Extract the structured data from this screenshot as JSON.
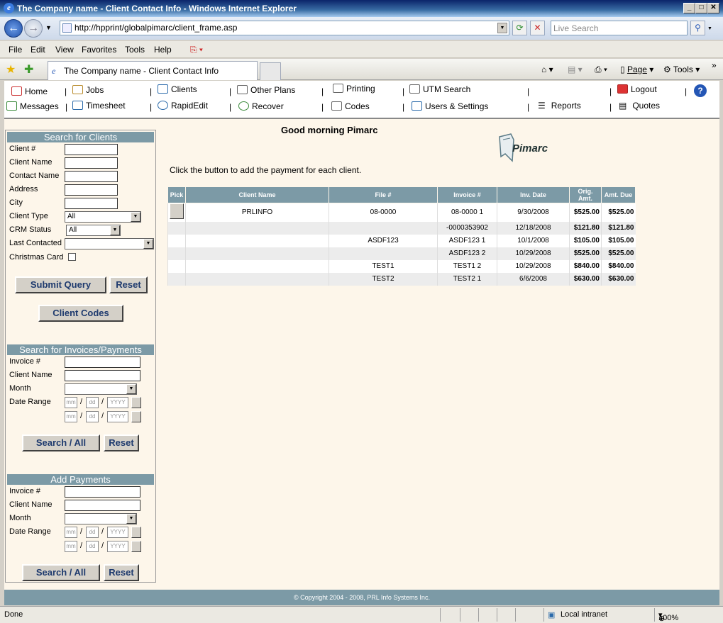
{
  "window": {
    "title": "The Company name - Client Contact Info - Windows Internet Explorer"
  },
  "browser": {
    "url": "http://hpprint/globalpimarc/client_frame.asp",
    "search_placeholder": "Live Search",
    "menu": [
      "File",
      "Edit",
      "View",
      "Favorites",
      "Tools",
      "Help"
    ],
    "tab_title": "The Company name - Client Contact Info",
    "commands": {
      "page": "Page",
      "tools": "Tools"
    },
    "status_left": "Done",
    "zone": "Local intranet",
    "zoom": "100%"
  },
  "appnav": {
    "home": "Home",
    "jobs": "Jobs",
    "clients": "Clients",
    "other_plans": "Other Plans",
    "printing": "Printing",
    "utm_search": "UTM Search",
    "logout": "Logout",
    "messages": "Messages",
    "timesheet": "Timesheet",
    "rapidedit": "RapidEdit",
    "recover": "Recover",
    "codes": "Codes",
    "users_settings": "Users & Settings",
    "reports": "Reports",
    "quotes": "Quotes"
  },
  "search_clients": {
    "header": "Search for Clients",
    "client_num": "Client #",
    "client_name": "Client Name",
    "contact_name": "Contact Name",
    "address": "Address",
    "city": "City",
    "client_type": "Client Type",
    "client_type_value": "All",
    "crm_status": "CRM Status",
    "crm_status_value": "All",
    "last_contacted": "Last Contacted",
    "christmas_card": "Christmas Card",
    "submit": "Submit Query",
    "reset": "Reset",
    "client_codes": "Client Codes"
  },
  "search_invoices": {
    "header": "Search for Invoices/Payments",
    "invoice_num": "Invoice #",
    "client_name": "Client Name",
    "month": "Month",
    "date_range": "Date Range",
    "mm": "mm",
    "dd": "dd",
    "yyyy": "YYYY",
    "search": "Search / All",
    "reset": "Reset"
  },
  "add_payments": {
    "header": "Add Payments",
    "invoice_num": "Invoice #",
    "client_name": "Client Name",
    "month": "Month",
    "date_range": "Date Range",
    "mm": "mm",
    "dd": "dd",
    "yyyy": "YYYY",
    "search": "Search / All",
    "reset": "Reset"
  },
  "main": {
    "greeting": "Good morning Pimarc",
    "logo_text": "Pimarc",
    "instruction": "Click the button to add the payment for each client.",
    "columns": [
      "Pick",
      "Client Name",
      "File #",
      "Invoice #",
      "Inv. Date",
      "Orig. Amt.",
      "Amt. Due"
    ],
    "rows": [
      {
        "client": "PRLINFO",
        "file": "08-0000",
        "invoice": "08-0000 1",
        "date": "9/30/2008",
        "orig": "$525.00",
        "due": "$525.00",
        "pick": true
      },
      {
        "client": "",
        "file": "",
        "invoice": "-0000353902",
        "date": "12/18/2008",
        "orig": "$121.80",
        "due": "$121.80"
      },
      {
        "client": "",
        "file": "ASDF123",
        "invoice": "ASDF123 1",
        "date": "10/1/2008",
        "orig": "$105.00",
        "due": "$105.00"
      },
      {
        "client": "",
        "file": "",
        "invoice": "ASDF123 2",
        "date": "10/29/2008",
        "orig": "$525.00",
        "due": "$525.00"
      },
      {
        "client": "",
        "file": "TEST1",
        "invoice": "TEST1 2",
        "date": "10/29/2008",
        "orig": "$840.00",
        "due": "$840.00"
      },
      {
        "client": "",
        "file": "TEST2",
        "invoice": "TEST2 1",
        "date": "6/6/2008",
        "orig": "$630.00",
        "due": "$630.00"
      }
    ],
    "footer": "© Copyright 2004 - 2008, PRL Info Systems Inc."
  }
}
